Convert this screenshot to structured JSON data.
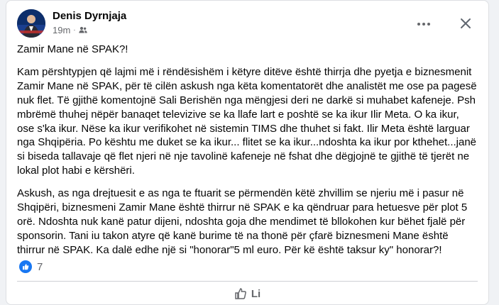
{
  "post": {
    "author": "Denis Dyrnjaja",
    "time": "19m",
    "dot": "·",
    "audience_icon": "friends-icon",
    "title": "Zamir Mane në SPAK?!",
    "paragraphs": [
      "Kam përshtypjen që lajmi më i rëndësishëm i këtyre ditëve është thirrja dhe pyetja e biznesmenit Zamir Mane në SPAK, për të cilën askush nga këta komentatorët dhe analistët me ose pa pagesë nuk flet. Të gjithë komentojnë Sali Berishën nga mëngjesi deri ne darkë si muhabet kafeneje. Psh mbrëmë thuhej nëpër banaqet televizive se ka llafe lart e poshtë se ka ikur Ilir Meta. O ka ikur, ose s'ka ikur. Nëse ka ikur verifikohet në sistemin TIMS dhe thuhet si fakt. Ilir Meta është larguar nga Shqipëria. Po kështu me duket se ka ikur... flitet se ka ikur...ndoshta ka ikur por  kthehet...janë si biseda tallavaje që flet njeri në nje tavolinë kafeneje në fshat dhe dëgjojnë te gjithë të tjerët ne lokal plot habi e kërshëri.",
      "Askush, as nga drejtuesit e as nga te ftuarit se përmendën këtë zhvillim se njeriu më i pasur në Shqipëri, biznesmeni Zamir Mane është thirrur në SPAK e ka qëndruar para hetuesve për plot 5 orë. Ndoshta nuk kanë patur dijeni, ndoshta goja dhe mendimet të bllokohen kur bëhet fjalë për sponsorin. Tani iu takon atyre që kanë burime të na thonë për çfarë biznesmeni Mane është thirrur në SPAK. Ka dalë edhe një si \"honorar\"5 ml euro. Për kë është taksur ky\" honorar?!"
    ],
    "reaction_count": "7",
    "action_partial": "Li"
  },
  "icons": {
    "more": "more-icon",
    "close": "close-icon",
    "like": "like-icon"
  },
  "colors": {
    "accent": "#1877f2",
    "secondary_text": "#65676b",
    "primary_text": "#050505"
  }
}
